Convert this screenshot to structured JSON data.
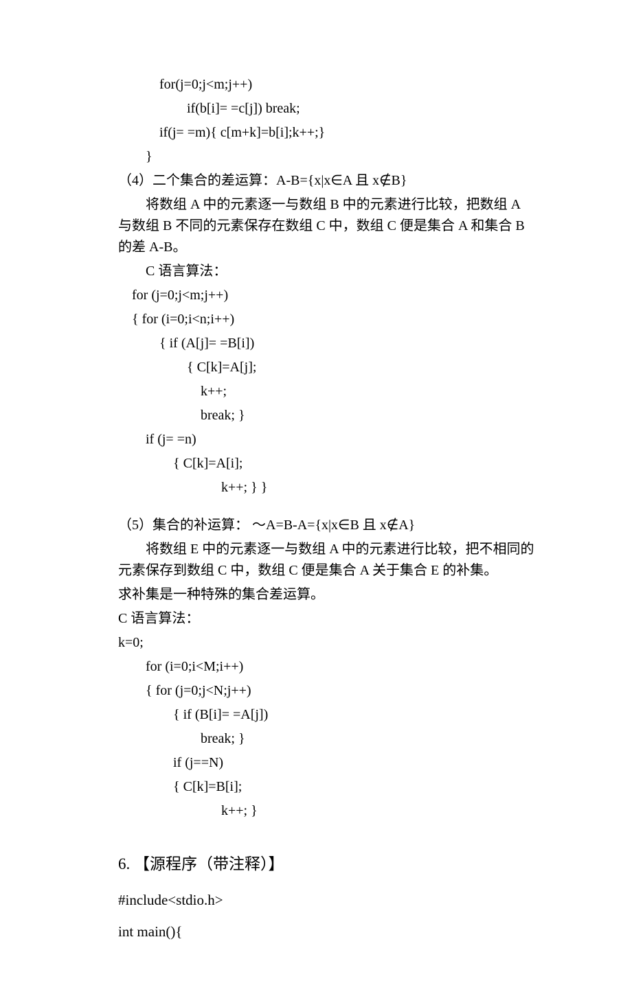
{
  "lines": {
    "l01": "for(j=0;j<m;j++)",
    "l02": "if(b[i]= =c[j]) break;",
    "l03": "if(j= =m){ c[m+k]=b[i];k++;}",
    "l04": "}",
    "l05": "（4）二个集合的差运算：A-B={x|x∈A 且 x∉B}",
    "l06": "将数组 A 中的元素逐一与数组 B 中的元素进行比较，把数组 A 与数组 B 不同的元素保存在数组 C 中，数组 C 便是集合 A 和集合 B 的差 A-B。",
    "l07": "C 语言算法：",
    "l08": "for (j=0;j<m;j++)",
    "l09": "{   for (i=0;i<n;i++)",
    "l10": "{   if (A[j]= =B[i])",
    "l11": "{   C[k]=A[j];",
    "l12": "k++;",
    "l13": "break; }",
    "l14": "if (j= =n)",
    "l15": "{   C[k]=A[i];",
    "l16": "k++;  }   }",
    "l17": "（5）集合的补运算：  ～A=B-A={x|x∈B 且 x∉A}",
    "l18": "将数组 E 中的元素逐一与数组 A 中的元素进行比较，把不相同的元素保存到数组 C 中，数组 C 便是集合 A 关于集合 E 的补集。",
    "l19": "求补集是一种特殊的集合差运算。",
    "l20": "C 语言算法：",
    "l21": "k=0;",
    "l22": "for (i=0;i<M;i++)",
    "l23": "{   for (j=0;j<N;j++)",
    "l24": "{       if (B[i]= =A[j])",
    "l25": "break;       }",
    "l26": "if (j==N)",
    "l27": "{   C[k]=B[i];",
    "l28": "k++;  }"
  },
  "heading": "6.  【源程序（带注释）】",
  "code": {
    "c1": "#include<stdio.h>",
    "c2": "int main(){"
  }
}
